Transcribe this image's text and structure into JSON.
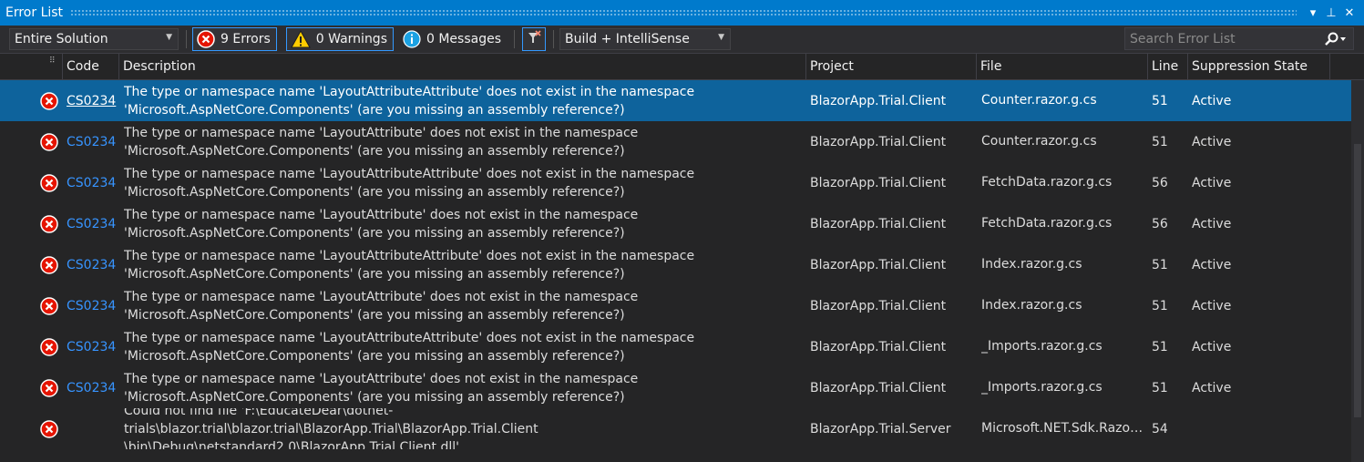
{
  "window": {
    "title": "Error List",
    "buttons": {
      "dropdown": "▾",
      "pin": "⊥",
      "close": "✕"
    }
  },
  "toolbar": {
    "scope": "Entire Solution",
    "errors_label": "9 Errors",
    "warnings_label": "0 Warnings",
    "messages_label": "0 Messages",
    "build_filter": "Build + IntelliSense",
    "search_placeholder": "Search Error List"
  },
  "columns": {
    "code": "Code",
    "description": "Description",
    "project": "Project",
    "file": "File",
    "line": "Line",
    "suppression": "Suppression State"
  },
  "rows": [
    {
      "code": "CS0234",
      "desc1": "The type or namespace name 'LayoutAttributeAttribute' does not exist in the namespace",
      "desc2": "'Microsoft.AspNetCore.Components' (are you missing an assembly reference?)",
      "project": "BlazorApp.Trial.Client",
      "file": "Counter.razor.g.cs",
      "line": "51",
      "suppression": "Active",
      "selected": true
    },
    {
      "code": "CS0234",
      "desc1": "The type or namespace name 'LayoutAttribute' does not exist in the namespace",
      "desc2": "'Microsoft.AspNetCore.Components' (are you missing an assembly reference?)",
      "project": "BlazorApp.Trial.Client",
      "file": "Counter.razor.g.cs",
      "line": "51",
      "suppression": "Active"
    },
    {
      "code": "CS0234",
      "desc1": "The type or namespace name 'LayoutAttributeAttribute' does not exist in the namespace",
      "desc2": "'Microsoft.AspNetCore.Components' (are you missing an assembly reference?)",
      "project": "BlazorApp.Trial.Client",
      "file": "FetchData.razor.g.cs",
      "line": "56",
      "suppression": "Active"
    },
    {
      "code": "CS0234",
      "desc1": "The type or namespace name 'LayoutAttribute' does not exist in the namespace",
      "desc2": "'Microsoft.AspNetCore.Components' (are you missing an assembly reference?)",
      "project": "BlazorApp.Trial.Client",
      "file": "FetchData.razor.g.cs",
      "line": "56",
      "suppression": "Active"
    },
    {
      "code": "CS0234",
      "desc1": "The type or namespace name 'LayoutAttributeAttribute' does not exist in the namespace",
      "desc2": "'Microsoft.AspNetCore.Components' (are you missing an assembly reference?)",
      "project": "BlazorApp.Trial.Client",
      "file": "Index.razor.g.cs",
      "line": "51",
      "suppression": "Active"
    },
    {
      "code": "CS0234",
      "desc1": "The type or namespace name 'LayoutAttribute' does not exist in the namespace",
      "desc2": "'Microsoft.AspNetCore.Components' (are you missing an assembly reference?)",
      "project": "BlazorApp.Trial.Client",
      "file": "Index.razor.g.cs",
      "line": "51",
      "suppression": "Active"
    },
    {
      "code": "CS0234",
      "desc1": "The type or namespace name 'LayoutAttributeAttribute' does not exist in the namespace",
      "desc2": "'Microsoft.AspNetCore.Components' (are you missing an assembly reference?)",
      "project": "BlazorApp.Trial.Client",
      "file": "_Imports.razor.g.cs",
      "line": "51",
      "suppression": "Active"
    },
    {
      "code": "CS0234",
      "desc1": "The type or namespace name 'LayoutAttribute' does not exist in the namespace",
      "desc2": "'Microsoft.AspNetCore.Components' (are you missing an assembly reference?)",
      "project": "BlazorApp.Trial.Client",
      "file": "_Imports.razor.g.cs",
      "line": "51",
      "suppression": "Active"
    },
    {
      "code": "",
      "desc1": "Could not find file 'F:\\EducateDear\\dotnet-trials\\blazor.trial\\blazor.trial\\BlazorApp.Trial\\BlazorApp.Trial.Client",
      "desc2": "\\bin\\Debug\\netstandard2.0\\BlazorApp.Trial.Client.dll'.",
      "project": "BlazorApp.Trial.Server",
      "file": "Microsoft.NET.Sdk.Razor....",
      "line": "54",
      "suppression": ""
    }
  ],
  "colors": {
    "title_bar": "#007acc",
    "selection": "#0e639c",
    "error_red": "#e51400",
    "warning_yellow": "#ffcc00",
    "info_blue": "#1ba1e2",
    "link_blue": "#3794ff"
  }
}
